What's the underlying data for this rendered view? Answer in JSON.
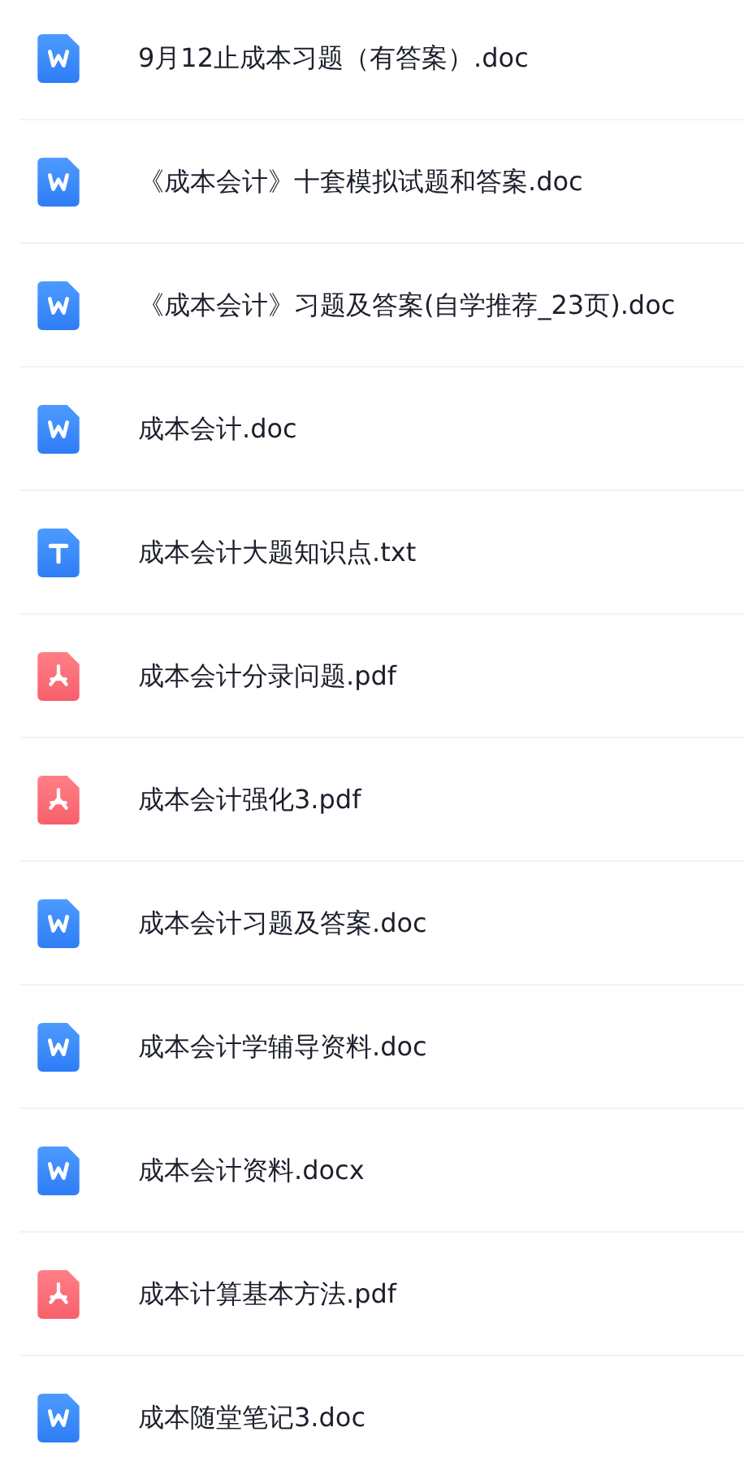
{
  "files": [
    {
      "name": "9月12止成本习题（有答案）.doc",
      "kind": "word"
    },
    {
      "name": "《成本会计》十套模拟试题和答案.doc",
      "kind": "word"
    },
    {
      "name": "《成本会计》习题及答案(自学推荐_23页).doc",
      "kind": "word"
    },
    {
      "name": "成本会计.doc",
      "kind": "word"
    },
    {
      "name": "成本会计大题知识点.txt",
      "kind": "text"
    },
    {
      "name": "成本会计分录问题.pdf",
      "kind": "pdf"
    },
    {
      "name": "成本会计强化3.pdf",
      "kind": "pdf"
    },
    {
      "name": "成本会计习题及答案.doc",
      "kind": "word"
    },
    {
      "name": "成本会计学辅导资料.doc",
      "kind": "word"
    },
    {
      "name": "成本会计资料.docx",
      "kind": "word"
    },
    {
      "name": "成本计算基本方法.pdf",
      "kind": "pdf"
    },
    {
      "name": "成本随堂笔记3.doc",
      "kind": "word"
    }
  ]
}
